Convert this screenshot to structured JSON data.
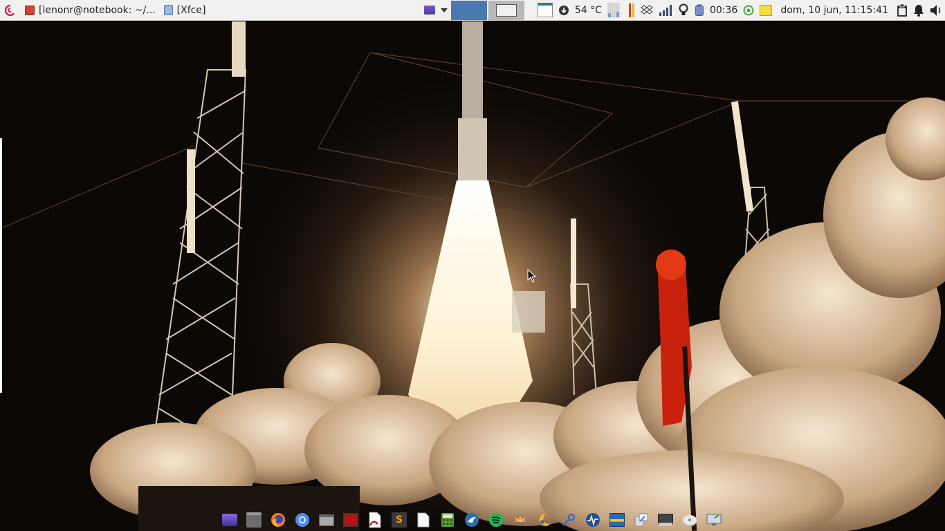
{
  "panel": {
    "tasks": [
      {
        "label": "[lenonr@notebook: ~/...",
        "icon": "terminal-icon"
      },
      {
        "label": "[Xfce]",
        "icon": "window-icon"
      }
    ],
    "temperature": "54 °C",
    "battery_time": "00:36",
    "clock": "dom, 10 jun, 11:15:41"
  },
  "colors": {
    "panel_bg": "#f1f1ef",
    "workspace_active": "#4a78b1",
    "debian_red": "#d70751"
  },
  "dock": {
    "items": [
      "terminal-icon",
      "file-manager-icon",
      "firefox-icon",
      "chromium-icon",
      "window-icon",
      "screenshot-icon",
      "document-viewer-icon",
      "sublime-text-icon",
      "text-file-icon",
      "calculator-icon",
      "bird-app-icon",
      "spotify-icon",
      "orange-app-icon",
      "moon-app-icon",
      "tools-icon",
      "system-monitor-icon",
      "image-viewer-icon",
      "resize-icon",
      "taskbar-icon",
      "disk-icon",
      "remote-desktop-icon"
    ]
  }
}
